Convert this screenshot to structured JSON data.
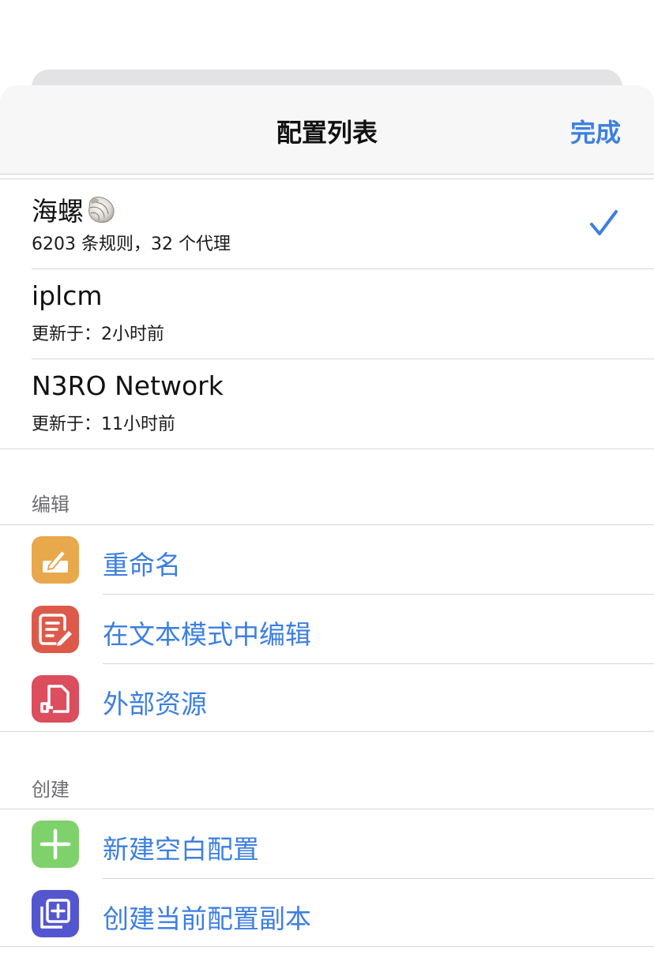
{
  "nav": {
    "title": "配置列表",
    "done_label": "完成"
  },
  "profiles": [
    {
      "name": "海螺",
      "icon": "shell-emoji-icon",
      "subtitle": "6203 条规则，32 个代理",
      "selected": true
    },
    {
      "name": "iplcm",
      "subtitle": "更新于：2小时前",
      "selected": false
    },
    {
      "name": "N3RO Network",
      "subtitle": "更新于：11小时前",
      "selected": false
    }
  ],
  "sections": {
    "edit": {
      "header": "编辑",
      "items": [
        {
          "label": "重命名",
          "icon": "rename-pencil-icon",
          "color": "#e8a84c"
        },
        {
          "label": "在文本模式中编辑",
          "icon": "text-edit-icon",
          "color": "#dd5a4a"
        },
        {
          "label": "外部资源",
          "icon": "external-resource-icon",
          "color": "#dc4d5e"
        }
      ]
    },
    "create": {
      "header": "创建",
      "items": [
        {
          "label": "新建空白配置",
          "icon": "plus-icon",
          "color": "#7fd26b"
        },
        {
          "label": "创建当前配置副本",
          "icon": "duplicate-icon",
          "color": "#5456cf"
        }
      ]
    }
  },
  "colors": {
    "accent": "#3d7fe0",
    "checkmark": "#3d7fe0"
  }
}
